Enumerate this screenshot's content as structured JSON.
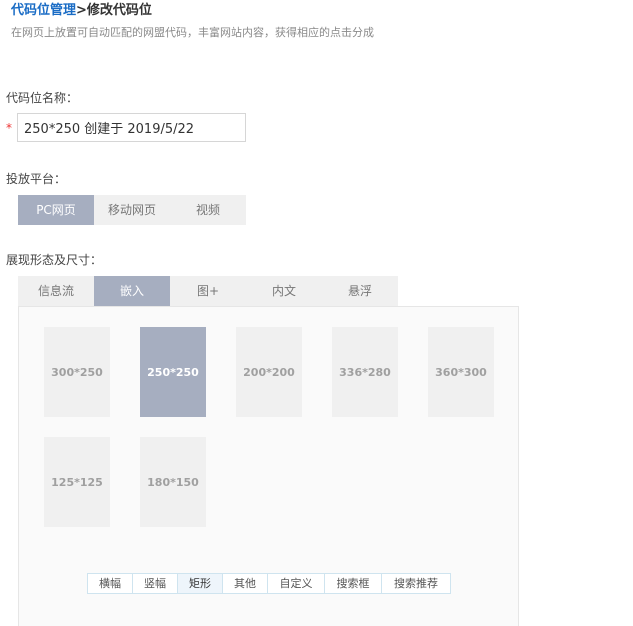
{
  "breadcrumb": {
    "parent": "代码位管理",
    "separator": ">",
    "current": "修改代码位"
  },
  "subtitle": "在网页上放置可自动匹配的网盟代码，丰富网站内容，获得相应的点击分成",
  "name_field": {
    "label": "代码位名称：",
    "required_mark": "*",
    "value": "250*250 创建于 2019/5/22"
  },
  "platform": {
    "label": "投放平台：",
    "options": [
      "PC网页",
      "移动网页",
      "视频"
    ],
    "selected": "PC网页"
  },
  "display": {
    "label": "展现形态及尺寸：",
    "tabs": [
      "信息流",
      "嵌入",
      "图+",
      "内文",
      "悬浮"
    ],
    "selected_tab": "嵌入",
    "sizes": [
      "300*250",
      "250*250",
      "200*200",
      "336*280",
      "360*300",
      "125*125",
      "180*150"
    ],
    "selected_size": "250*250",
    "filters": [
      "横幅",
      "竖幅",
      "矩形",
      "其他",
      "自定义",
      "搜索框",
      "搜索推荐"
    ],
    "selected_filter": "矩形"
  },
  "colors": {
    "link": "#1a6cc5",
    "selected_bg": "#a6aec0",
    "required": "#ee3333"
  }
}
